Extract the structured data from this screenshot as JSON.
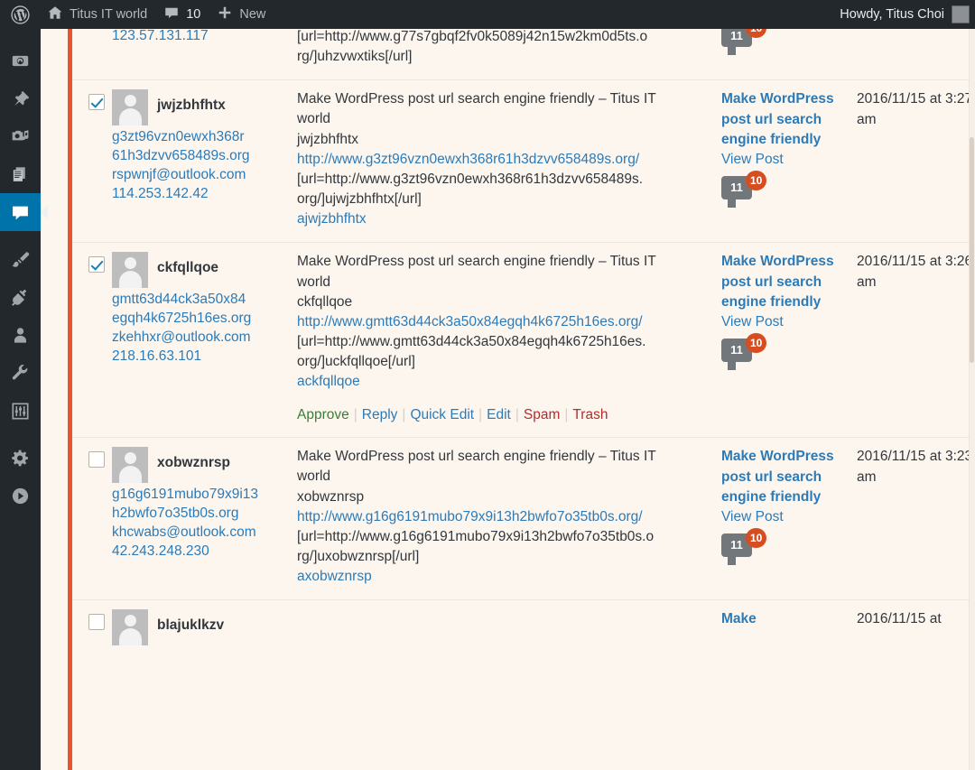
{
  "adminbar": {
    "logo_icon": "wordpress-logo-icon",
    "site_icon": "home-icon",
    "site_name": "Titus IT world",
    "comments_icon": "comment-bubble-icon",
    "comments_count": "10",
    "new_icon": "plus-icon",
    "new_label": "New",
    "howdy": "Howdy, Titus Choi",
    "avatar_icon": "user-avatar-icon"
  },
  "sidebar": {
    "items": [
      {
        "name": "dashboard",
        "icon": "dashboard-gauge-icon",
        "current": false
      },
      {
        "name": "posts",
        "icon": "pushpin-icon",
        "current": false
      },
      {
        "name": "media",
        "icon": "camera-music-icon",
        "current": false
      },
      {
        "name": "pages",
        "icon": "pages-stack-icon",
        "current": false
      },
      {
        "name": "comments",
        "icon": "comment-bubble-icon",
        "current": true
      },
      {
        "name": "appearance",
        "icon": "paintbrush-icon",
        "current": false
      },
      {
        "name": "plugins",
        "icon": "plug-icon",
        "current": false
      },
      {
        "name": "users",
        "icon": "user-icon",
        "current": false
      },
      {
        "name": "tools",
        "icon": "wrench-icon",
        "current": false
      },
      {
        "name": "settings-panel",
        "icon": "sliders-box-icon",
        "current": false
      },
      {
        "name": "settings",
        "icon": "gear-icon",
        "current": false
      },
      {
        "name": "collapse-menu",
        "icon": "play-circle-icon",
        "current": false
      }
    ]
  },
  "colors": {
    "accent_rail": "#e8542f",
    "admin_dark": "#23282d",
    "current_blue": "#0073aa",
    "link_blue": "#2b7bb9",
    "approve_green": "#3a7d36",
    "danger_red": "#b32d2e",
    "badge_orange": "#d54e21",
    "page_bg": "#fdf6ef"
  },
  "row_actions": {
    "approve": "Approve",
    "reply": "Reply",
    "quick_edit": "Quick Edit",
    "edit": "Edit",
    "spam": "Spam",
    "trash": "Trash",
    "separator": "|"
  },
  "labels": {
    "view_post": "View Post"
  },
  "partial_top": {
    "author_ip": "123.57.131.117",
    "comment_lines": [
      "[url=http://www.g77s7gbqf2fv0k5089j42n15w2km0d5ts.o",
      "rg/]uhzvwxtiks[/url]"
    ],
    "bubble_count": "11",
    "bubble_badge": "10"
  },
  "partial_bottom": {
    "author_name": "blajuklkzv",
    "response_link": "Make",
    "date": "2016/11/15 at"
  },
  "rows": [
    {
      "checked": true,
      "author": {
        "name": "jwjzbhfhtx",
        "url_lines": [
          "g3zt96vzn0ewxh368r",
          "61h3dzvv658489s.org"
        ],
        "email": "rspwnjf@outlook.com",
        "ip": "114.253.142.42"
      },
      "comment": {
        "lines": [
          {
            "text": "Make WordPress post url search engine friendly – Titus IT",
            "link": false
          },
          {
            "text": "world",
            "link": false
          },
          {
            "text": "jwjzbhfhtx",
            "link": false
          },
          {
            "text": "http://www.g3zt96vzn0ewxh368r61h3dzvv658489s.org/",
            "link": true
          },
          {
            "text": "[url=http://www.g3zt96vzn0ewxh368r61h3dzvv658489s.",
            "link": false
          },
          {
            "text": "org/]ujwjzbhfhtx[/url]",
            "link": false
          },
          {
            "text": "ajwjzbhfhtx",
            "link": true
          }
        ],
        "show_actions": false
      },
      "response": {
        "title": "Make WordPress post url search engine friendly",
        "bubble_count": "11",
        "bubble_badge": "10"
      },
      "date": "2016/11/15 at 3:27 am"
    },
    {
      "checked": true,
      "author": {
        "name": "ckfqllqoe",
        "url_lines": [
          "gmtt63d44ck3a50x84",
          "egqh4k6725h16es.org"
        ],
        "email": "zkehhxr@outlook.com",
        "ip": "218.16.63.101"
      },
      "comment": {
        "lines": [
          {
            "text": "Make WordPress post url search engine friendly – Titus IT",
            "link": false
          },
          {
            "text": "world",
            "link": false
          },
          {
            "text": "ckfqllqoe",
            "link": false
          },
          {
            "text": "http://www.gmtt63d44ck3a50x84egqh4k6725h16es.org/",
            "link": true
          },
          {
            "text": "[url=http://www.gmtt63d44ck3a50x84egqh4k6725h16es.",
            "link": false
          },
          {
            "text": "org/]uckfqllqoe[/url]",
            "link": false
          },
          {
            "text": "ackfqllqoe",
            "link": true
          }
        ],
        "show_actions": true
      },
      "response": {
        "title": "Make WordPress post url search engine friendly",
        "bubble_count": "11",
        "bubble_badge": "10"
      },
      "date": "2016/11/15 at 3:26 am"
    },
    {
      "checked": false,
      "author": {
        "name": "xobwznrsp",
        "url_lines": [
          "g16g6191mubo79x9i13",
          "h2bwfo7o35tb0s.org"
        ],
        "email": "khcwabs@outlook.com",
        "ip": "42.243.248.230"
      },
      "comment": {
        "lines": [
          {
            "text": "Make WordPress post url search engine friendly – Titus IT",
            "link": false
          },
          {
            "text": "world",
            "link": false
          },
          {
            "text": "xobwznrsp",
            "link": false
          },
          {
            "text": "http://www.g16g6191mubo79x9i13h2bwfo7o35tb0s.org/",
            "link": true
          },
          {
            "text": "[url=http://www.g16g6191mubo79x9i13h2bwfo7o35tb0s.o",
            "link": false
          },
          {
            "text": "rg/]uxobwznrsp[/url]",
            "link": false
          },
          {
            "text": "axobwznrsp",
            "link": true
          }
        ],
        "show_actions": false
      },
      "response": {
        "title": "Make WordPress post url search engine friendly",
        "bubble_count": "11",
        "bubble_badge": "10"
      },
      "date": "2016/11/15 at 3:23 am"
    }
  ]
}
